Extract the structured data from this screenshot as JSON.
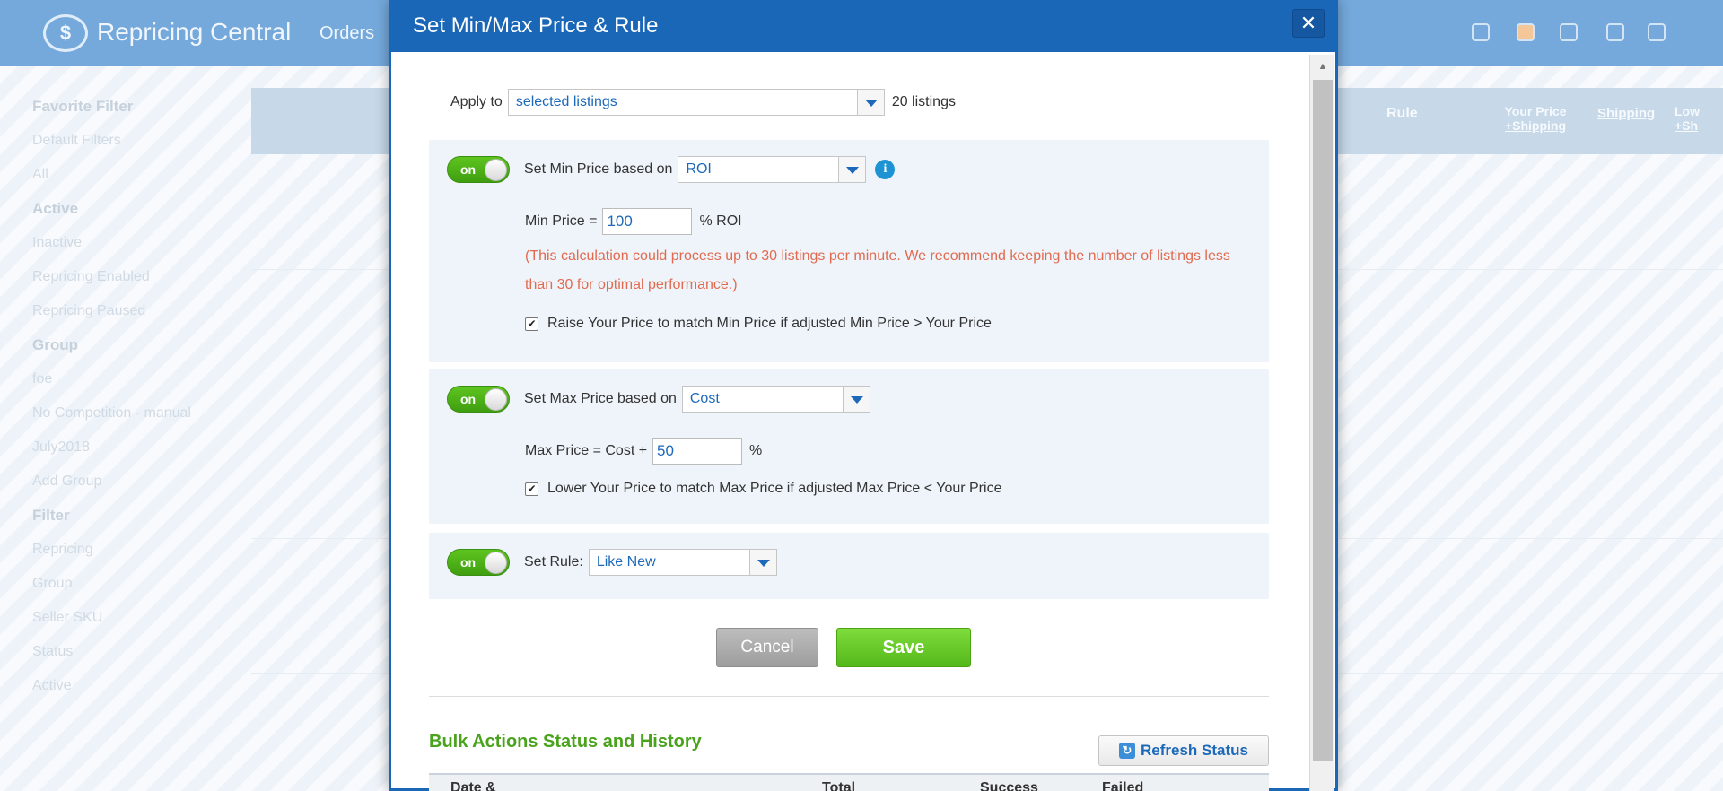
{
  "background": {
    "app_title": "Repricing Central",
    "nav_orders": "Orders",
    "sidebar": [
      {
        "label": "Favorite Filter",
        "heading": true
      },
      {
        "label": "Default Filters",
        "heading": false
      },
      {
        "label": "All",
        "heading": false
      },
      {
        "label": "Active",
        "heading": true
      },
      {
        "label": "Inactive",
        "heading": false
      },
      {
        "label": "Repricing Enabled",
        "heading": false
      },
      {
        "label": "Repricing Paused",
        "heading": false
      },
      {
        "label": "Group",
        "heading": true
      },
      {
        "label": "foe",
        "heading": false
      },
      {
        "label": "No Competition - manual",
        "heading": false
      },
      {
        "label": "July2018",
        "heading": false
      },
      {
        "label": "Add Group",
        "heading": false
      },
      {
        "label": "Filter",
        "heading": true
      },
      {
        "label": "Repricing",
        "heading": false
      },
      {
        "label": "Group",
        "heading": false
      },
      {
        "label": "Seller SKU",
        "heading": false
      },
      {
        "label": "Status",
        "heading": false
      },
      {
        "label": "Active",
        "heading": false
      }
    ],
    "table_headers": {
      "rule": "Rule",
      "your_price": "Your Price +Shipping",
      "shipping": "Shipping",
      "lowest": "Low +Sh"
    }
  },
  "modal": {
    "title": "Set Min/Max Price & Rule",
    "close_glyph": "✕",
    "apply_to": {
      "label": "Apply to",
      "value": "selected listings",
      "count_text": "20 listings"
    },
    "min_section": {
      "toggle_text": "on",
      "label": "Set Min Price based on",
      "basis": "ROI",
      "info_glyph": "i",
      "formula_prefix": "Min Price =",
      "value": "100",
      "formula_suffix": "% ROI",
      "warning": "(This calculation could process up to 30 listings per minute. We recommend keeping the number of listings less than 30 for optimal performance.)",
      "checkbox_label": "Raise Your Price to match Min Price if adjusted Min Price > Your Price",
      "checked": true
    },
    "max_section": {
      "toggle_text": "on",
      "label": "Set Max Price based on",
      "basis": "Cost",
      "formula_prefix": "Max Price = Cost +",
      "value": "50",
      "formula_suffix": "%",
      "checkbox_label": "Lower Your Price to match Max Price if adjusted Max Price < Your Price",
      "checked": true
    },
    "rule_section": {
      "toggle_text": "on",
      "label": "Set Rule:",
      "value": "Like New"
    },
    "buttons": {
      "cancel": "Cancel",
      "save": "Save"
    },
    "history": {
      "title": "Bulk Actions Status and History",
      "refresh_label": "Refresh Status",
      "columns": [
        "Date &",
        "Total",
        "Success",
        "Failed"
      ]
    }
  }
}
